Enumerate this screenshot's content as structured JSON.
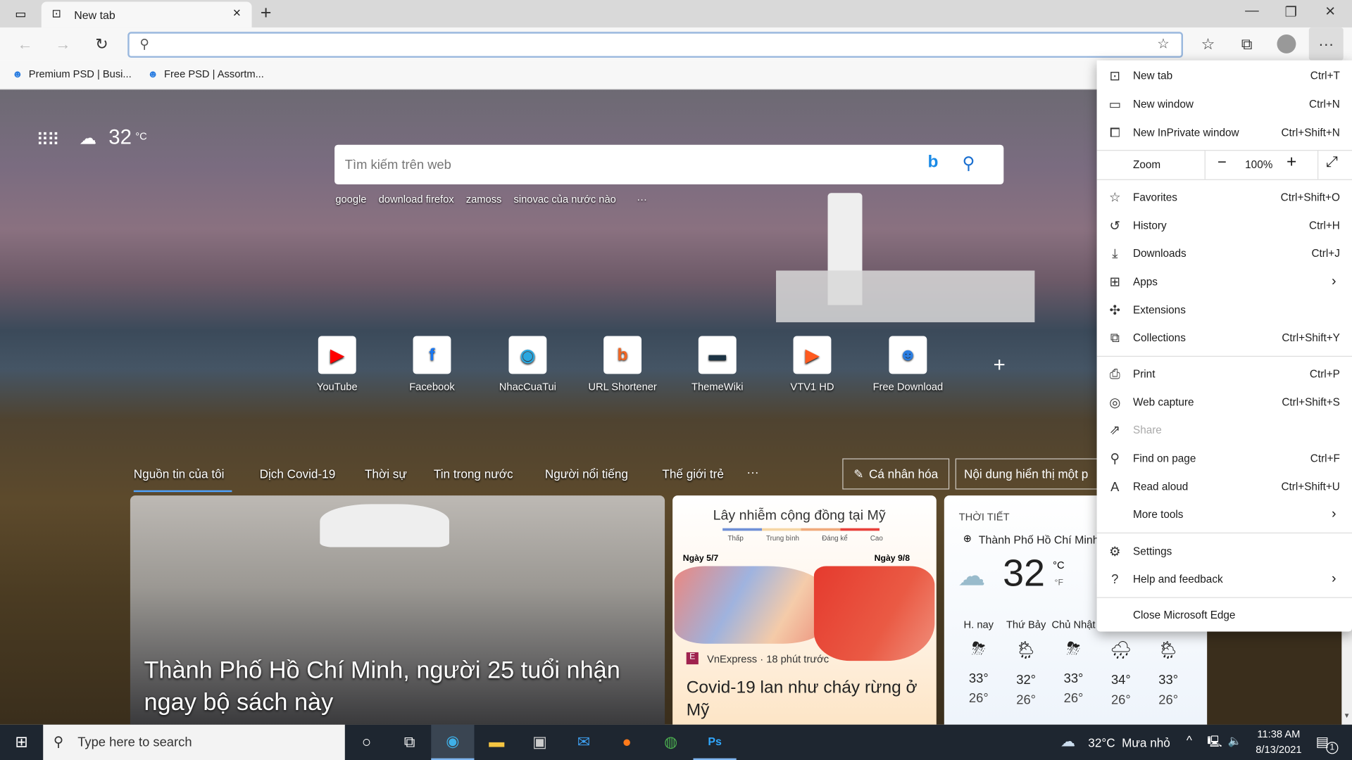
{
  "browser": {
    "tab_title": "New tab",
    "address_value": "",
    "address_placeholder": ""
  },
  "favorites": [
    {
      "label": "Premium PSD | Busi..."
    },
    {
      "label": "Free PSD | Assortm..."
    }
  ],
  "ntp": {
    "weather_temp": "32",
    "weather_unit": "°C",
    "search_placeholder": "Tìm kiếm trên web",
    "trending": [
      "google",
      "download firefox",
      "zamoss",
      "sinovac của nước nào"
    ],
    "more": "···",
    "tiles": [
      {
        "label": "YouTube",
        "color": "#ff0000",
        "glyph": "▶"
      },
      {
        "label": "Facebook",
        "color": "#1877f2",
        "glyph": "f"
      },
      {
        "label": "NhacCuaTui",
        "color": "#2aa7e0",
        "glyph": "◉"
      },
      {
        "label": "URL Shortener",
        "color": "#f26522",
        "glyph": "b"
      },
      {
        "label": "ThemeWiki",
        "color": "#1c3344",
        "glyph": "▬"
      },
      {
        "label": "VTV1 HD",
        "color": "#ff5a1f",
        "glyph": "▶"
      },
      {
        "label": "Free Download",
        "color": "#2a7de1",
        "glyph": "☻"
      }
    ],
    "categories": [
      "Nguồn tin của tôi",
      "Dịch Covid-19",
      "Thời sự",
      "Tin trong nước",
      "Người nổi tiếng",
      "Thế giới trẻ"
    ],
    "personalize": "Cá nhân hóa",
    "content_visible": "Nội dung hiển thị một p",
    "hero_headline": "Thành Phố Hồ Chí Minh, người 25 tuổi nhận ngay bộ sách này",
    "card2": {
      "map_title": "Lây nhiễm cộng đồng tại Mỹ",
      "legend": [
        "Thấp",
        "Trung bình",
        "Đáng kể",
        "Cao"
      ],
      "left_date": "Ngày 5/7",
      "right_date": "Ngày 9/8",
      "source": "VnExpress · 18 phút trước",
      "headline": "Covid-19 lan như cháy rừng ở Mỹ"
    },
    "weather_card": {
      "title": "THỜI TIẾT",
      "location": "Thành Phố Hồ Chí Minh",
      "temp": "32",
      "unit_c": "°C",
      "unit_f": "°F",
      "forecast": [
        {
          "day": "H. nay",
          "hi": "33°",
          "lo": "26°",
          "icon": "⛈"
        },
        {
          "day": "Thứ Bảy",
          "hi": "32°",
          "lo": "26°",
          "icon": "🌦"
        },
        {
          "day": "Chủ Nhật",
          "hi": "33°",
          "lo": "26°",
          "icon": "⛈"
        },
        {
          "day": "",
          "hi": "34°",
          "lo": "26°",
          "icon": "🌧"
        },
        {
          "day": "",
          "hi": "33°",
          "lo": "26°",
          "icon": "🌦"
        }
      ]
    }
  },
  "menu": {
    "items": [
      {
        "label": "New tab",
        "shortcut": "Ctrl+T",
        "icon": "new-tab-icon"
      },
      {
        "label": "New window",
        "shortcut": "Ctrl+N",
        "icon": "window-icon"
      },
      {
        "label": "New InPrivate window",
        "shortcut": "Ctrl+Shift+N",
        "icon": "inprivate-icon"
      },
      {
        "label": "Favorites",
        "shortcut": "Ctrl+Shift+O",
        "icon": "favorites-icon"
      },
      {
        "label": "History",
        "shortcut": "Ctrl+H",
        "icon": "history-icon"
      },
      {
        "label": "Downloads",
        "shortcut": "Ctrl+J",
        "icon": "download-icon"
      },
      {
        "label": "Apps",
        "shortcut": "",
        "icon": "apps-icon"
      },
      {
        "label": "Extensions",
        "shortcut": "",
        "icon": "extensions-icon"
      },
      {
        "label": "Collections",
        "shortcut": "Ctrl+Shift+Y",
        "icon": "collections-icon"
      },
      {
        "label": "Print",
        "shortcut": "Ctrl+P",
        "icon": "print-icon"
      },
      {
        "label": "Web capture",
        "shortcut": "Ctrl+Shift+S",
        "icon": "web-capture-icon"
      },
      {
        "label": "Share",
        "shortcut": "",
        "icon": "share-icon"
      },
      {
        "label": "Find on page",
        "shortcut": "Ctrl+F",
        "icon": "find-icon"
      },
      {
        "label": "Read aloud",
        "shortcut": "Ctrl+Shift+U",
        "icon": "read-aloud-icon"
      },
      {
        "label": "More tools",
        "shortcut": "",
        "icon": ""
      },
      {
        "label": "Settings",
        "shortcut": "",
        "icon": "gear-icon"
      },
      {
        "label": "Help and feedback",
        "shortcut": "",
        "icon": "help-icon"
      },
      {
        "label": "Close Microsoft Edge",
        "shortcut": "",
        "icon": ""
      }
    ],
    "zoom_label": "Zoom",
    "zoom_value": "100%"
  },
  "taskbar": {
    "search_placeholder": "Type here to search",
    "weather": "32°C  Mưa nhỏ",
    "time": "11:38 AM",
    "date": "8/13/2021",
    "notifications": "1"
  }
}
